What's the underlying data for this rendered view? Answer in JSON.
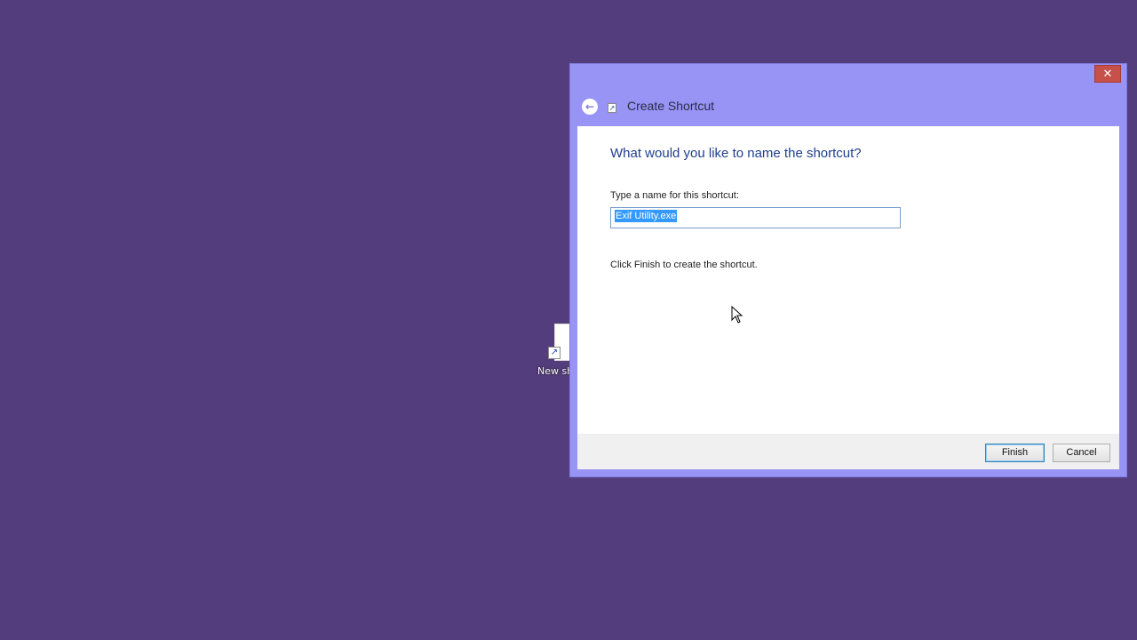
{
  "desktop": {
    "shortcut_label": "New sh"
  },
  "dialog": {
    "title": "Create Shortcut",
    "close_glyph": "✕",
    "back_glyph": "←",
    "heading": "What would you like to name the shortcut?",
    "field_label": "Type a name for this shortcut:",
    "name_value": "Exif Utility.exe",
    "finish_note": "Click Finish to create the shortcut.",
    "buttons": {
      "finish": "Finish",
      "cancel": "Cancel"
    }
  },
  "colors": {
    "desktop_bg": "#543d7c",
    "window_frame": "#9794f5",
    "close_red": "#c7504a",
    "heading_blue": "#1e3e8e",
    "selection": "#3399ff"
  }
}
